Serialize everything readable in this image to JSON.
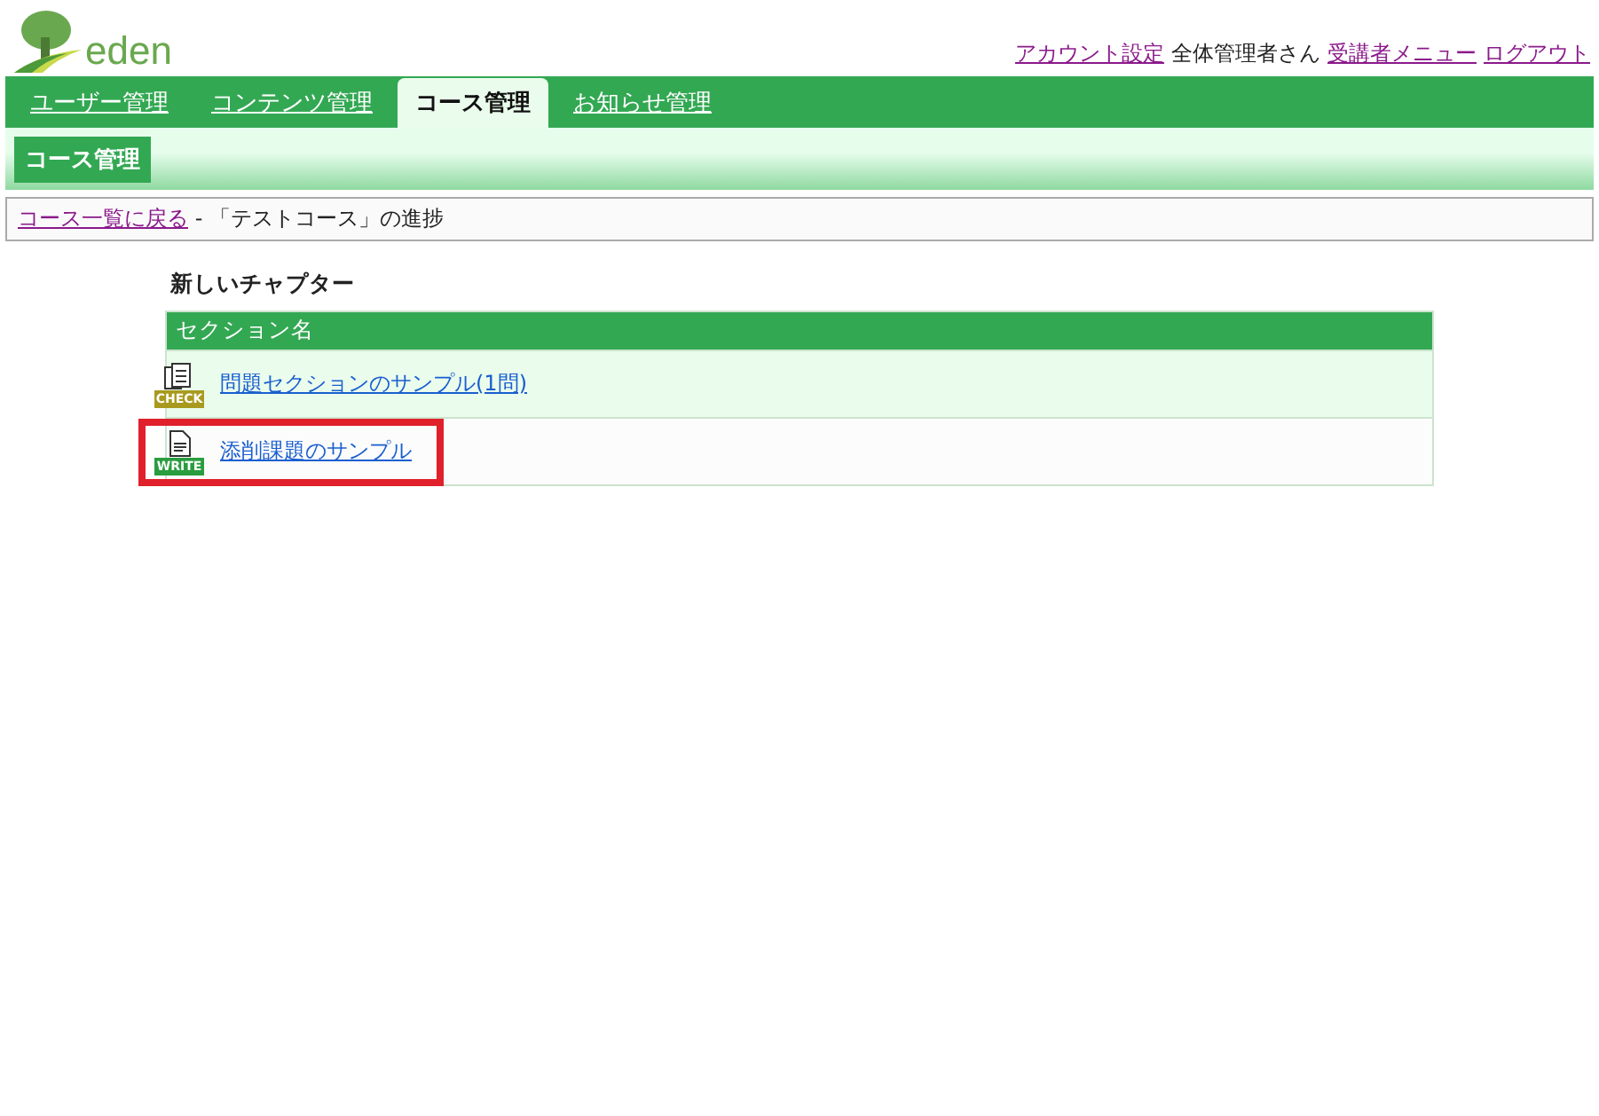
{
  "logo": {
    "text": "eden"
  },
  "header_links": [
    {
      "kind": "link",
      "text": "アカウント設定"
    },
    {
      "kind": "text",
      "text": "全体管理者さん"
    },
    {
      "kind": "link",
      "text": "受講者メニュー"
    },
    {
      "kind": "link",
      "text": "ログアウト"
    }
  ],
  "tabs": [
    {
      "label": "ユーザー管理",
      "selected": false
    },
    {
      "label": "コンテンツ管理",
      "selected": false
    },
    {
      "label": "コース管理",
      "selected": true
    },
    {
      "label": "お知らせ管理",
      "selected": false
    }
  ],
  "sub_nav": {
    "label": "コース管理"
  },
  "breadcrumb": {
    "link": "コース一覧に戻る",
    "text": " - 「テストコース」の進捗"
  },
  "chapter": {
    "title": "新しいチャプター",
    "column": "セクション名",
    "rows": [
      {
        "kind": "check",
        "badge": "CHECK",
        "title": "問題セクションのサンプル(1問)",
        "highlighted": false
      },
      {
        "kind": "write",
        "badge": "WRITE",
        "title": "添削課題のサンプル",
        "highlighted": true
      }
    ]
  }
}
